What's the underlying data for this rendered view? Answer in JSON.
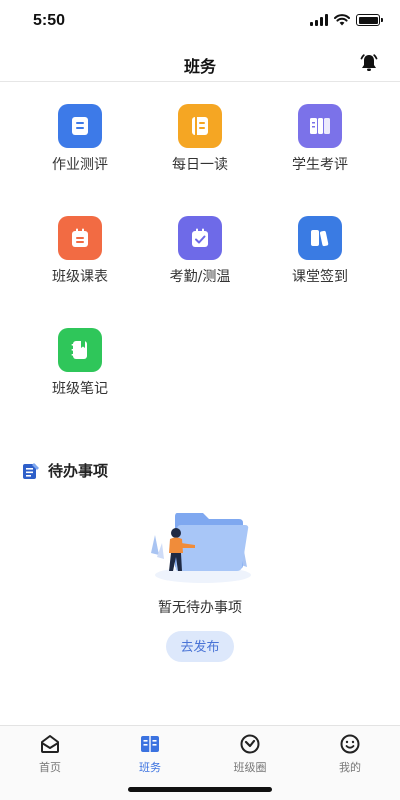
{
  "status_bar": {
    "time": "5:50",
    "icons": [
      "signal-icon",
      "wifi-icon",
      "battery-icon"
    ]
  },
  "nav": {
    "title": "班务",
    "right_icon": "bell-icon"
  },
  "grid": [
    {
      "label": "作业测评",
      "icon": "homework-icon",
      "color": "#3d7ae8"
    },
    {
      "label": "每日一读",
      "icon": "daily-read-icon",
      "color": "#f5a623"
    },
    {
      "label": "学生考评",
      "icon": "student-eval-icon",
      "color": "#7b72e9"
    },
    {
      "label": "班级课表",
      "icon": "schedule-icon",
      "color": "#f26b43"
    },
    {
      "label": "考勤/测温",
      "icon": "attendance-icon",
      "color": "#6e6ae8"
    },
    {
      "label": "课堂签到",
      "icon": "checkin-icon",
      "color": "#3a7be3"
    },
    {
      "label": "班级笔记",
      "icon": "notes-icon",
      "color": "#2fc65a"
    }
  ],
  "todo": {
    "section_title": "待办事项",
    "empty_text": "暂无待办事项",
    "publish_label": "去发布"
  },
  "tabs": [
    {
      "label": "首页",
      "icon": "home-icon",
      "active": false
    },
    {
      "label": "班务",
      "icon": "class-affairs-icon",
      "active": true
    },
    {
      "label": "班级圈",
      "icon": "class-circle-icon",
      "active": false
    },
    {
      "label": "我的",
      "icon": "profile-icon",
      "active": false
    }
  ],
  "colors": {
    "accent": "#3b72e0",
    "publish_bg": "#dde8fb"
  }
}
